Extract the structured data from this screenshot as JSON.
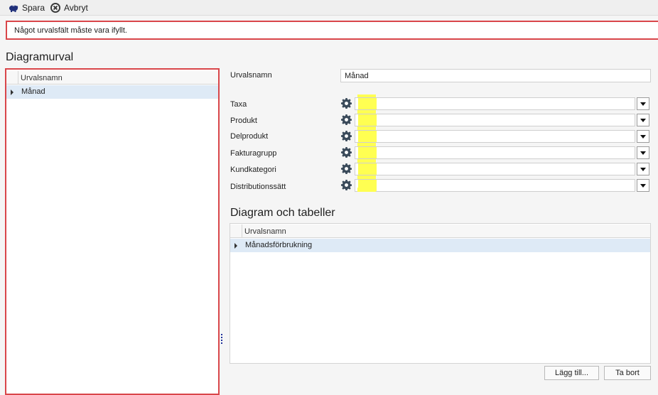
{
  "toolbar": {
    "save_label": "Spara",
    "cancel_label": "Avbryt"
  },
  "error_message": "Något urvalsfält måste vara ifyllt.",
  "left": {
    "title": "Diagramurval",
    "column_header": "Urvalsnamn",
    "rows": [
      "Månad"
    ]
  },
  "form": {
    "name_label": "Urvalsnamn",
    "name_value": "Månad",
    "filters": [
      {
        "label": "Taxa",
        "value": ""
      },
      {
        "label": "Produkt",
        "value": ""
      },
      {
        "label": "Delprodukt",
        "value": ""
      },
      {
        "label": "Fakturagrupp",
        "value": ""
      },
      {
        "label": "Kundkategori",
        "value": ""
      },
      {
        "label": "Distributionssätt",
        "value": ""
      }
    ]
  },
  "charts": {
    "title": "Diagram och tabeller",
    "column_header": "Urvalsnamn",
    "rows": [
      "Månadsförbrukning"
    ]
  },
  "buttons": {
    "add_label": "Lägg till...",
    "remove_label": "Ta bort"
  },
  "colors": {
    "error_border": "#d9464a",
    "selected_row": "#deeaf6",
    "highlight": "#ffff52"
  },
  "icons": {
    "save": "piggy-bank-icon",
    "cancel": "cancel-circle-icon",
    "settings": "gear-icon",
    "dropdown": "chevron-down-icon",
    "row_indicator": "row-arrow-icon"
  }
}
